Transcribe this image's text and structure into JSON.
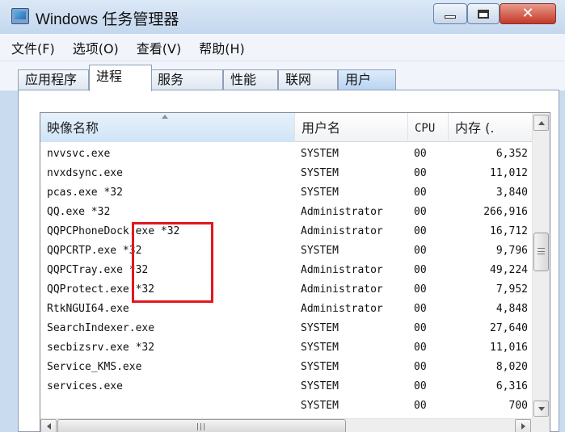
{
  "window": {
    "title": "Windows 任务管理器",
    "close_glyph": "✕"
  },
  "menu": [
    "文件(F)",
    "选项(O)",
    "查看(V)",
    "帮助(H)"
  ],
  "tabs": [
    "应用程序",
    "进程",
    "服务",
    "性能",
    "联网",
    "用户"
  ],
  "active_tab": "进程",
  "columns": {
    "name": "映像名称",
    "user": "用户名",
    "cpu": "CPU",
    "mem": "内存 (."
  },
  "processes": [
    {
      "name": "nvvsvc.exe",
      "user": "SYSTEM",
      "cpu": "00",
      "mem": "6,352"
    },
    {
      "name": "nvxdsync.exe",
      "user": "SYSTEM",
      "cpu": "00",
      "mem": "11,012"
    },
    {
      "name": "pcas.exe *32",
      "user": "SYSTEM",
      "cpu": "00",
      "mem": "3,840"
    },
    {
      "name": "QQ.exe *32",
      "user": "Administrator",
      "cpu": "00",
      "mem": "266,916"
    },
    {
      "name": "QQPCPhoneDock.exe *32",
      "user": "Administrator",
      "cpu": "00",
      "mem": "16,712"
    },
    {
      "name": "QQPCRTP.exe *32",
      "user": "SYSTEM",
      "cpu": "00",
      "mem": "9,796"
    },
    {
      "name": "QQPCTray.exe *32",
      "user": "Administrator",
      "cpu": "00",
      "mem": "49,224"
    },
    {
      "name": "QQProtect.exe *32",
      "user": "Administrator",
      "cpu": "00",
      "mem": "7,952"
    },
    {
      "name": "RtkNGUI64.exe",
      "user": "Administrator",
      "cpu": "00",
      "mem": "4,848"
    },
    {
      "name": "SearchIndexer.exe",
      "user": "SYSTEM",
      "cpu": "00",
      "mem": "27,640"
    },
    {
      "name": "secbizsrv.exe *32",
      "user": "SYSTEM",
      "cpu": "00",
      "mem": "11,016"
    },
    {
      "name": "Service_KMS.exe",
      "user": "SYSTEM",
      "cpu": "00",
      "mem": "8,020"
    },
    {
      "name": "services.exe",
      "user": "SYSTEM",
      "cpu": "00",
      "mem": "6,316"
    },
    {
      "name": "",
      "user": "SYSTEM",
      "cpu": "00",
      "mem": "700"
    }
  ],
  "colors": {
    "annotation": "#e0181e",
    "title_bar": "#c3d7ee",
    "close_button": "#c4392a"
  }
}
